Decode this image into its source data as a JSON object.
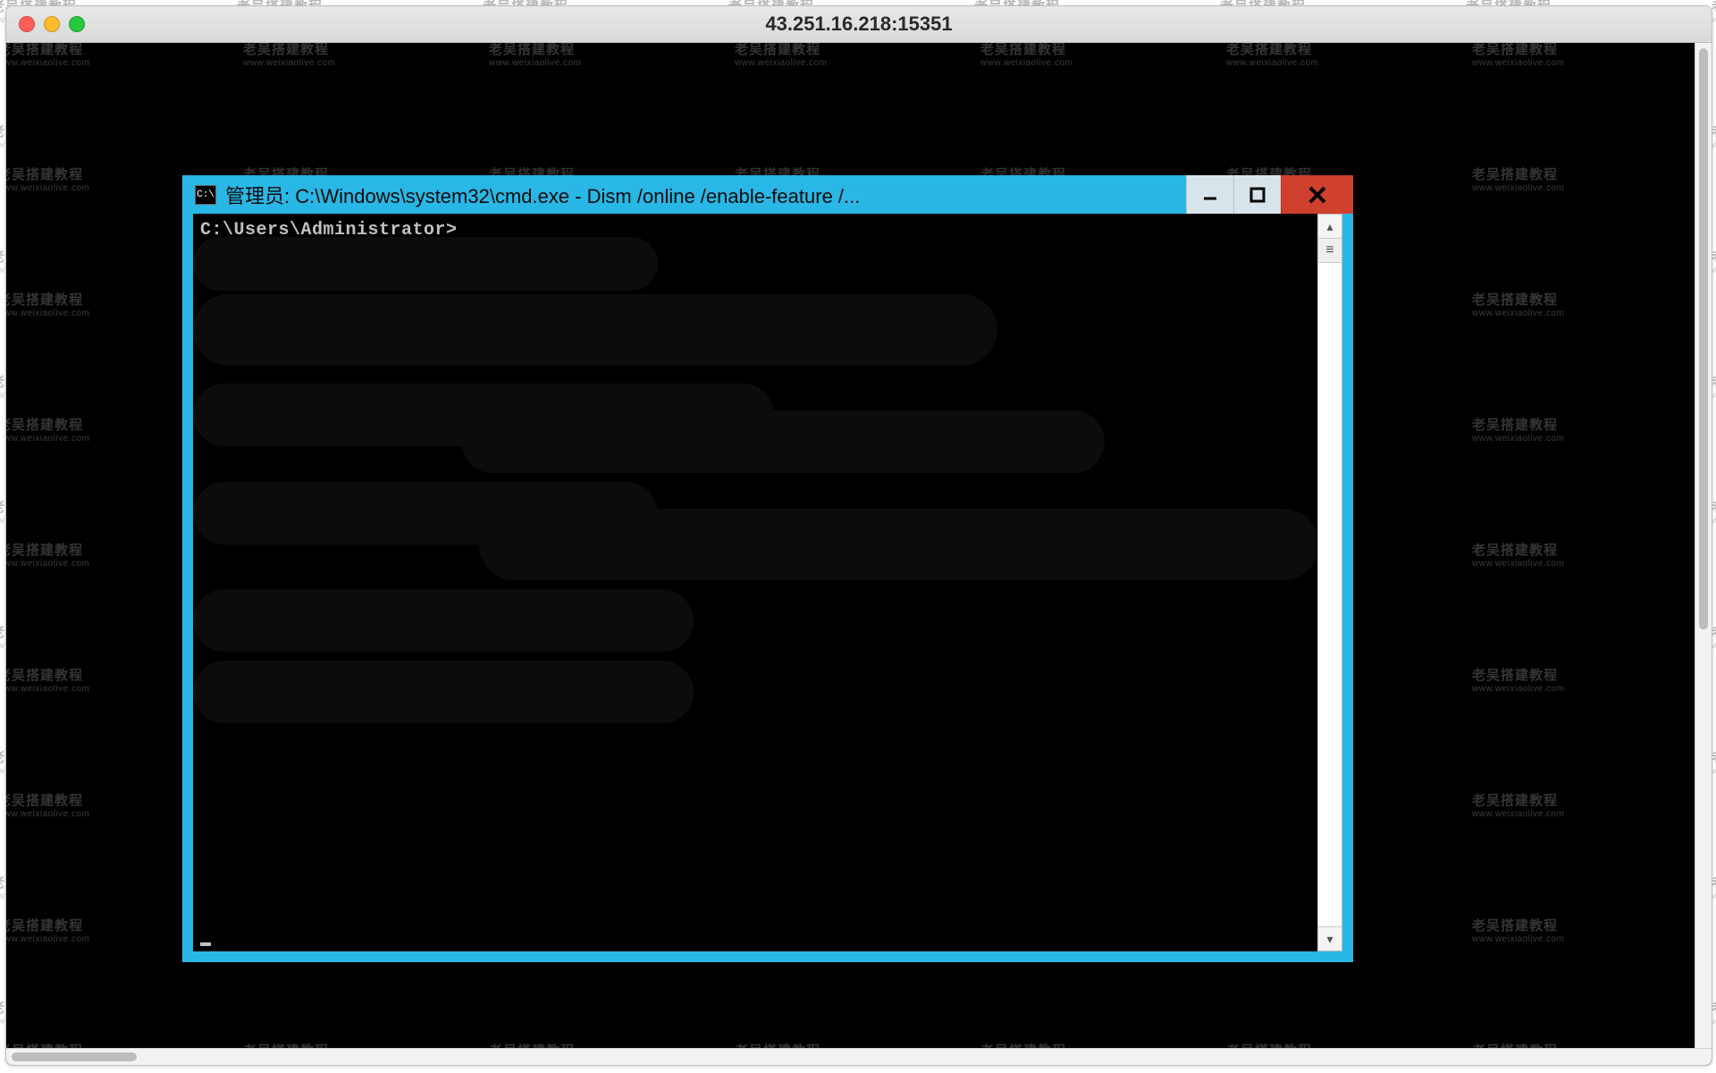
{
  "watermark": {
    "line1": "老吴搭建教程",
    "line2": "www.weixiaolive.com"
  },
  "mac": {
    "title": "43.251.16.218:15351"
  },
  "cmd": {
    "titlebar_icon_text": "C:\\",
    "title": "管理员: C:\\Windows\\system32\\cmd.exe - Dism  /online /enable-feature /...",
    "prompt": "C:\\Users\\Administrator>",
    "scroll_up": "▴",
    "scroll_opts": "≡",
    "scroll_down": "▾"
  }
}
